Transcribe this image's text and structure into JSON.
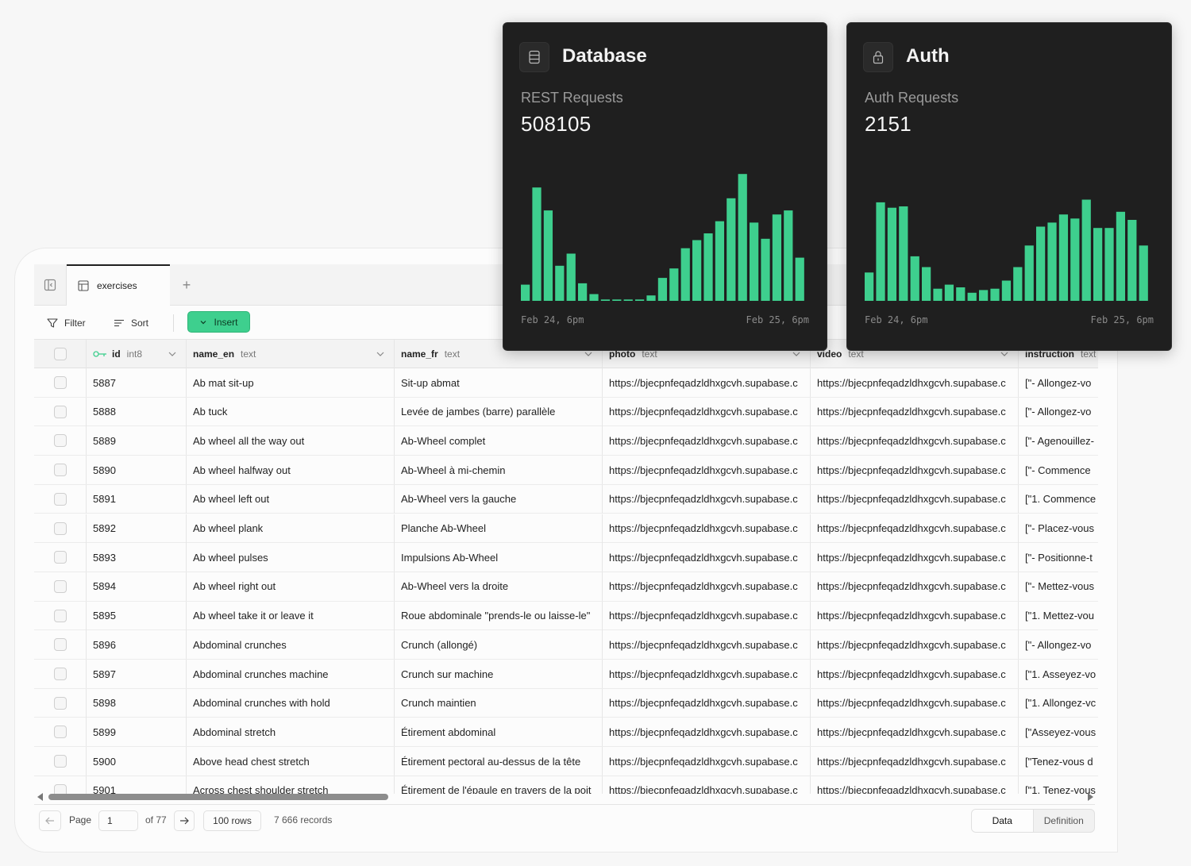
{
  "table_tab": {
    "label": "exercises",
    "add_label": "+"
  },
  "toolbar": {
    "filter_label": "Filter",
    "sort_label": "Sort",
    "insert_label": "Insert"
  },
  "columns": [
    {
      "name": "id",
      "type": "int8"
    },
    {
      "name": "name_en",
      "type": "text"
    },
    {
      "name": "name_fr",
      "type": "text"
    },
    {
      "name": "photo",
      "type": "text"
    },
    {
      "name": "video",
      "type": "text"
    },
    {
      "name": "instruction",
      "type": "text"
    }
  ],
  "rows": [
    {
      "id": "5887",
      "name_en": "Ab mat sit-up",
      "name_fr": "Sit-up abmat",
      "photo": "https://bjecpnfeqadzldhxgcvh.supabase.c",
      "video": "https://bjecpnfeqadzldhxgcvh.supabase.c",
      "instruction": "[\"- Allongez-vo"
    },
    {
      "id": "5888",
      "name_en": "Ab tuck",
      "name_fr": "Levée de jambes (barre) parallèle",
      "photo": "https://bjecpnfeqadzldhxgcvh.supabase.c",
      "video": "https://bjecpnfeqadzldhxgcvh.supabase.c",
      "instruction": "[\"- Allongez-vo"
    },
    {
      "id": "5889",
      "name_en": "Ab wheel all the way out",
      "name_fr": "Ab-Wheel complet",
      "photo": "https://bjecpnfeqadzldhxgcvh.supabase.c",
      "video": "https://bjecpnfeqadzldhxgcvh.supabase.c",
      "instruction": "[\"- Agenouillez-"
    },
    {
      "id": "5890",
      "name_en": "Ab wheel halfway out",
      "name_fr": "Ab-Wheel à mi-chemin",
      "photo": "https://bjecpnfeqadzldhxgcvh.supabase.c",
      "video": "https://bjecpnfeqadzldhxgcvh.supabase.c",
      "instruction": "[\"- Commence"
    },
    {
      "id": "5891",
      "name_en": "Ab wheel left out",
      "name_fr": "Ab-Wheel vers la gauche",
      "photo": "https://bjecpnfeqadzldhxgcvh.supabase.c",
      "video": "https://bjecpnfeqadzldhxgcvh.supabase.c",
      "instruction": "[\"1. Commence"
    },
    {
      "id": "5892",
      "name_en": "Ab wheel plank",
      "name_fr": "Planche Ab-Wheel",
      "photo": "https://bjecpnfeqadzldhxgcvh.supabase.c",
      "video": "https://bjecpnfeqadzldhxgcvh.supabase.c",
      "instruction": "[\"- Placez-vous"
    },
    {
      "id": "5893",
      "name_en": "Ab wheel pulses",
      "name_fr": "Impulsions Ab-Wheel",
      "photo": "https://bjecpnfeqadzldhxgcvh.supabase.c",
      "video": "https://bjecpnfeqadzldhxgcvh.supabase.c",
      "instruction": "[\"- Positionne-t"
    },
    {
      "id": "5894",
      "name_en": "Ab wheel right out",
      "name_fr": "Ab-Wheel vers la droite",
      "photo": "https://bjecpnfeqadzldhxgcvh.supabase.c",
      "video": "https://bjecpnfeqadzldhxgcvh.supabase.c",
      "instruction": "[\"- Mettez-vous"
    },
    {
      "id": "5895",
      "name_en": "Ab wheel take it or leave it",
      "name_fr": "Roue abdominale \"prends-le ou laisse-le\"",
      "photo": "https://bjecpnfeqadzldhxgcvh.supabase.c",
      "video": "https://bjecpnfeqadzldhxgcvh.supabase.c",
      "instruction": "[\"1. Mettez-vou"
    },
    {
      "id": "5896",
      "name_en": "Abdominal crunches",
      "name_fr": "Crunch (allongé)",
      "photo": "https://bjecpnfeqadzldhxgcvh.supabase.c",
      "video": "https://bjecpnfeqadzldhxgcvh.supabase.c",
      "instruction": "[\"- Allongez-vo"
    },
    {
      "id": "5897",
      "name_en": "Abdominal crunches machine",
      "name_fr": "Crunch sur machine",
      "photo": "https://bjecpnfeqadzldhxgcvh.supabase.c",
      "video": "https://bjecpnfeqadzldhxgcvh.supabase.c",
      "instruction": "[\"1. Asseyez-vo"
    },
    {
      "id": "5898",
      "name_en": "Abdominal crunches with hold",
      "name_fr": "Crunch maintien",
      "photo": "https://bjecpnfeqadzldhxgcvh.supabase.c",
      "video": "https://bjecpnfeqadzldhxgcvh.supabase.c",
      "instruction": "[\"1. Allongez-vc"
    },
    {
      "id": "5899",
      "name_en": "Abdominal stretch",
      "name_fr": "Étirement abdominal",
      "photo": "https://bjecpnfeqadzldhxgcvh.supabase.c",
      "video": "https://bjecpnfeqadzldhxgcvh.supabase.c",
      "instruction": "[\"Asseyez-vous"
    },
    {
      "id": "5900",
      "name_en": "Above head chest stretch",
      "name_fr": "Étirement pectoral au-dessus de la tête",
      "photo": "https://bjecpnfeqadzldhxgcvh.supabase.c",
      "video": "https://bjecpnfeqadzldhxgcvh.supabase.c",
      "instruction": "[\"Tenez-vous d"
    },
    {
      "id": "5901",
      "name_en": "Across chest shoulder stretch",
      "name_fr": "Étirement de l'épaule en travers de la poit",
      "photo": "https://bjecpnfeqadzldhxgcvh.supabase.c",
      "video": "https://bjecpnfeqadzldhxgcvh.supabase.c",
      "instruction": "[\"1. Tenez-vous"
    }
  ],
  "pagination": {
    "page_label": "Page",
    "page_value": "1",
    "of_label": "of 77",
    "rows_label": "100 rows",
    "records_label": "7 666 records"
  },
  "view_toggle": {
    "data_label": "Data",
    "definition_label": "Definition",
    "selected": "Data"
  },
  "colors": {
    "accent": "#3ecf8e",
    "card_bg": "#1f1f1f"
  },
  "cards": [
    {
      "title": "Database",
      "icon": "database-icon",
      "metric_label": "REST Requests",
      "metric_value": "508105",
      "chart_data": {
        "type": "bar",
        "values": [
          12,
          84,
          67,
          26,
          35,
          13,
          5,
          1,
          1,
          1,
          1,
          4,
          17,
          24,
          39,
          45,
          50,
          59,
          76,
          94,
          58,
          46,
          64,
          67,
          32
        ],
        "x_start_label": "Feb 24, 6pm",
        "x_end_label": "Feb 25, 6pm"
      }
    },
    {
      "title": "Auth",
      "icon": "lock-icon",
      "metric_label": "Auth Requests",
      "metric_value": "2151",
      "chart_data": {
        "type": "bar",
        "values": [
          21,
          73,
          69,
          70,
          33,
          25,
          9,
          12,
          10,
          6,
          8,
          9,
          15,
          25,
          41,
          55,
          58,
          64,
          61,
          75,
          54,
          54,
          66,
          60,
          41
        ],
        "x_start_label": "Feb 24, 6pm",
        "x_end_label": "Feb 25, 6pm"
      }
    }
  ]
}
